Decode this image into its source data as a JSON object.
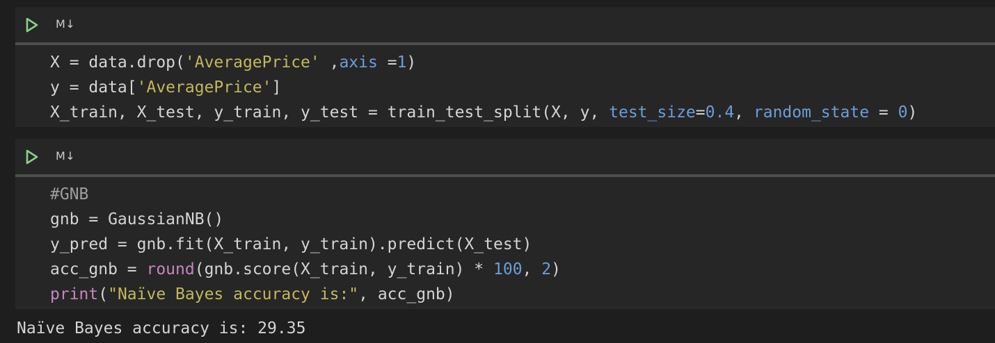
{
  "cells": [
    {
      "toolbar": {
        "run_label": "Run cell",
        "mode_label": "M↓"
      },
      "lines": [
        [
          {
            "t": "X = data.drop(",
            "c": ""
          },
          {
            "t": "'AveragePrice'",
            "c": "str"
          },
          {
            "t": " ,",
            "c": ""
          },
          {
            "t": "axis",
            "c": "kw"
          },
          {
            "t": " =",
            "c": ""
          },
          {
            "t": "1",
            "c": "num"
          },
          {
            "t": ")",
            "c": ""
          }
        ],
        [
          {
            "t": "y = data[",
            "c": ""
          },
          {
            "t": "'AveragePrice'",
            "c": "str"
          },
          {
            "t": "]",
            "c": ""
          }
        ],
        [
          {
            "t": "X_train, X_test, y_train, y_test = train_test_split(X, y, ",
            "c": ""
          },
          {
            "t": "test_size",
            "c": "kw"
          },
          {
            "t": "=",
            "c": ""
          },
          {
            "t": "0.4",
            "c": "num"
          },
          {
            "t": ", ",
            "c": ""
          },
          {
            "t": "random_state",
            "c": "kw"
          },
          {
            "t": " = ",
            "c": ""
          },
          {
            "t": "0",
            "c": "num"
          },
          {
            "t": ")",
            "c": ""
          }
        ]
      ]
    },
    {
      "toolbar": {
        "run_label": "Run cell",
        "mode_label": "M↓"
      },
      "lines": [
        [
          {
            "t": "#GNB",
            "c": "cm"
          }
        ],
        [
          {
            "t": "gnb = GaussianNB()",
            "c": ""
          }
        ],
        [
          {
            "t": "y_pred = gnb.fit(X_train, y_train).predict(X_test)",
            "c": ""
          }
        ],
        [
          {
            "t": "acc_gnb = ",
            "c": ""
          },
          {
            "t": "round",
            "c": "fn"
          },
          {
            "t": "(gnb.score(X_train, y_train) * ",
            "c": ""
          },
          {
            "t": "100",
            "c": "num"
          },
          {
            "t": ", ",
            "c": ""
          },
          {
            "t": "2",
            "c": "num"
          },
          {
            "t": ")",
            "c": ""
          }
        ],
        [
          {
            "t": "print",
            "c": "fn"
          },
          {
            "t": "(",
            "c": ""
          },
          {
            "t": "\"Naïve Bayes accuracy is:\"",
            "c": "str"
          },
          {
            "t": ", acc_gnb)",
            "c": ""
          }
        ]
      ],
      "output": "Naïve Bayes accuracy is: 29.35"
    }
  ],
  "colors": {
    "background": "#1e1e1e",
    "cell_background": "#262626",
    "run_icon": "#89d185",
    "string": "#c3b85b",
    "keyword": "#6b9ed8",
    "builtin": "#c586c0",
    "comment": "#9e9e9e",
    "text": "#d4d4d4"
  },
  "icons": {
    "run": "play-icon",
    "markdown": "markdown-toggle"
  }
}
